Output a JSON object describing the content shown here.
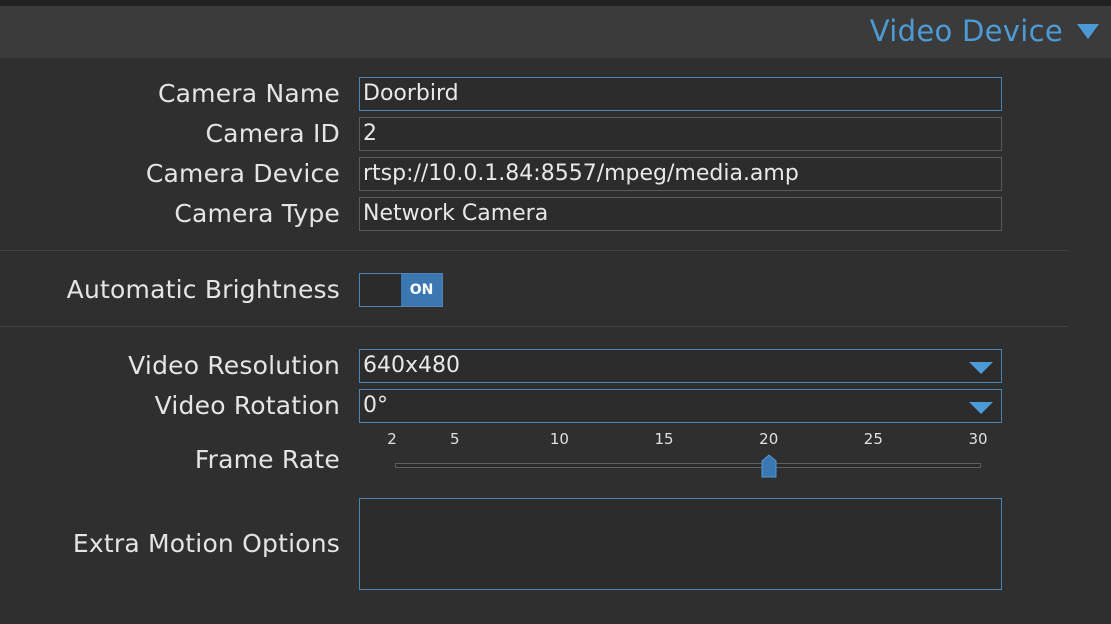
{
  "header": {
    "title": "Video Device",
    "chevron_icon": "chevron-down-icon"
  },
  "fields": {
    "camera_name": {
      "label": "Camera Name",
      "value": "Doorbird"
    },
    "camera_id": {
      "label": "Camera ID",
      "value": "2"
    },
    "camera_device": {
      "label": "Camera Device",
      "value": "rtsp://10.0.1.84:8557/mpeg/media.amp"
    },
    "camera_type": {
      "label": "Camera Type",
      "value": "Network Camera"
    }
  },
  "brightness": {
    "label": "Automatic Brightness",
    "toggle_text": "ON",
    "enabled": true
  },
  "resolution": {
    "label": "Video Resolution",
    "value": "640x480"
  },
  "rotation": {
    "label": "Video Rotation",
    "value": "0°"
  },
  "frame_rate": {
    "label": "Frame Rate",
    "ticks": [
      "2",
      "5",
      "10",
      "15",
      "20",
      "25",
      "30"
    ],
    "min": 2,
    "max": 30,
    "value": 20
  },
  "extra_motion": {
    "label": "Extra Motion Options",
    "value": ""
  },
  "colors": {
    "accent": "#4c9bd6",
    "background": "#2f2f2f",
    "header": "#3b3b3b",
    "toggle_on": "#3b78b1"
  }
}
